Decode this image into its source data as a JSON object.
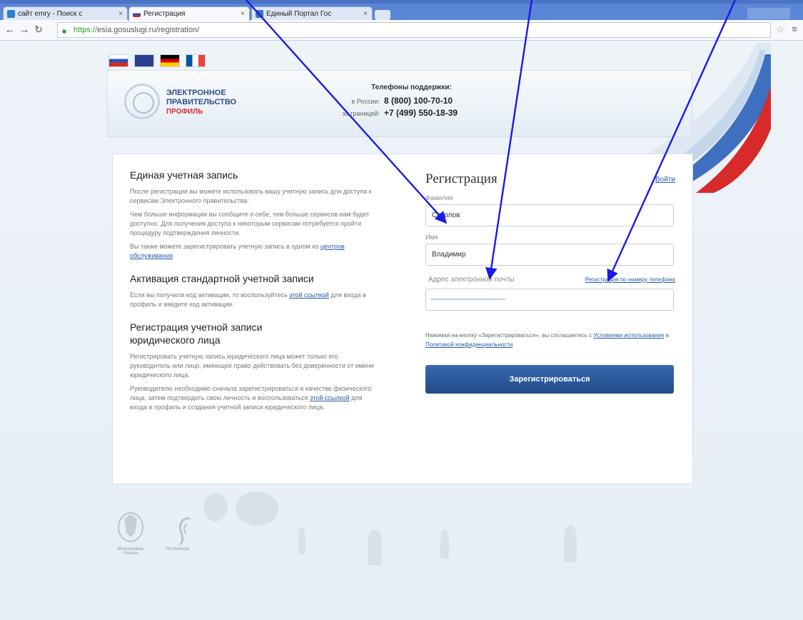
{
  "browser": {
    "tabs": [
      {
        "label": "сайт еmry - Поиск с",
        "close": "×"
      },
      {
        "label": "Регистрация",
        "close": "×"
      },
      {
        "label": "Единый Портал Гос",
        "close": "×"
      }
    ],
    "url_scheme": "https://",
    "url_rest": "esia.gosuslugi.ru/registration/"
  },
  "header": {
    "logo_line1": "ЭЛЕКТРОННОЕ",
    "logo_line2": "ПРАВИТЕЛЬСТВО",
    "logo_line3": "ПРОФИЛЬ",
    "support_title": "Телефоны поддержки:",
    "phone_ru_label": "в России:",
    "phone_ru": "8 (800) 100-70-10",
    "phone_abroad_label": "за границей:",
    "phone_abroad": "+7 (499) 550-18-39"
  },
  "info": {
    "s1_title": "Единая учетная запись",
    "s1_p1": "После регистрации вы можете использовать вашу учетную запись для доступа к сервисам Электронного правительства.",
    "s1_p2": "Чем больше информации вы сообщите о себе, тем больше сервисов вам будет доступно. Для получения доступа к некоторым сервисам потребуется пройти процедуру подтверждения личности.",
    "s1_p3": "Вы также можете зарегистрировать учетную запись в одном из",
    "s1_link": "центров обслуживания",
    "s2_title": "Активация стандартной учетной записи",
    "s2_p1": "Если вы получили код активации, то воспользуйтесь",
    "s2_link": "этой ссылкой",
    "s2_p2": "для входа в профиль и введите код активации.",
    "s3_title": "Регистрация учетной записи юридического лица",
    "s3_p1": "Регистрировать учетную запись юридического лица может только его руководитель или лицо, имеющее право действовать без доверенности от имени юридического лица.",
    "s3_p2": "Руководителю необходимо сначала зарегистрироваться в качестве физического лица, затем подтвердить свою личность и воспользоваться",
    "s3_link": "этой ссылкой",
    "s3_p3": "для входа в профиль и создания учетной записи юридического лица."
  },
  "form": {
    "title": "Регистрация",
    "login_link": "Войти",
    "surname_label": "Фамилия",
    "surname_value": "Соколов",
    "name_label": "Имя",
    "name_value": "Владимир",
    "email_label": "Адрес электронной почты",
    "phone_link": "Регистрация по номеру телефона",
    "email_value": "",
    "agree_text": "Нажимая на кнопку «Зарегистрироваться», вы соглашаетесь с",
    "terms_link": "Условиями использования",
    "and_text": "и",
    "privacy_link": "Политикой конфиденциальности",
    "submit_label": "Зарегистрироваться"
  },
  "footer": {
    "emblem_caption": "Минкомсвязь России",
    "rt_caption": "Ростелеком"
  },
  "colors": {
    "button": "#2a5699",
    "link": "#2a5ba6",
    "annotation_arrow": "#1a1ae6"
  }
}
